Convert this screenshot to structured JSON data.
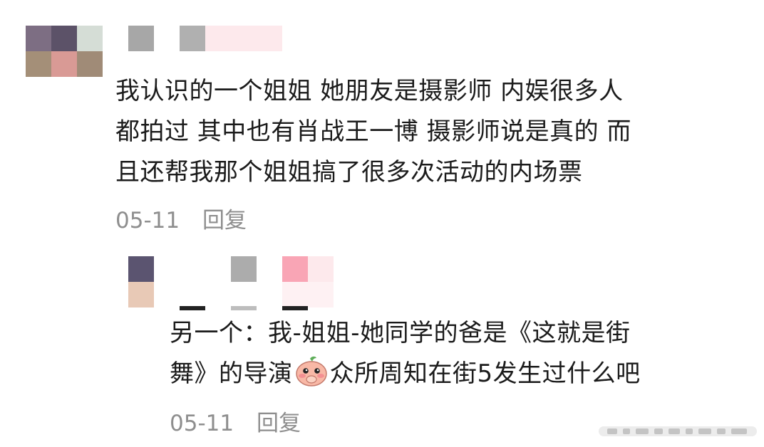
{
  "comments": [
    {
      "text_lines": [
        "我认识的一个姐姐 她朋友是摄影师 内娱很多人",
        "都拍过 其中也有肖战王一博 摄影师说是真的 而",
        "且还帮我那个姐姐搞了很多次活动的内场票"
      ],
      "date": "05-11",
      "reply_label": "回复"
    },
    {
      "text_line1": "另一个：我-姐姐-她同学的爸是《这就是街",
      "text_line2_before": "舞》的导演",
      "emoji": "peach-face-emoji",
      "text_line2_after": "众所周知在街5发生过什么吧",
      "date": "05-11",
      "reply_label": "回复"
    }
  ],
  "colors": {
    "text": "#1b1b1b",
    "meta": "#8e8e8e"
  }
}
